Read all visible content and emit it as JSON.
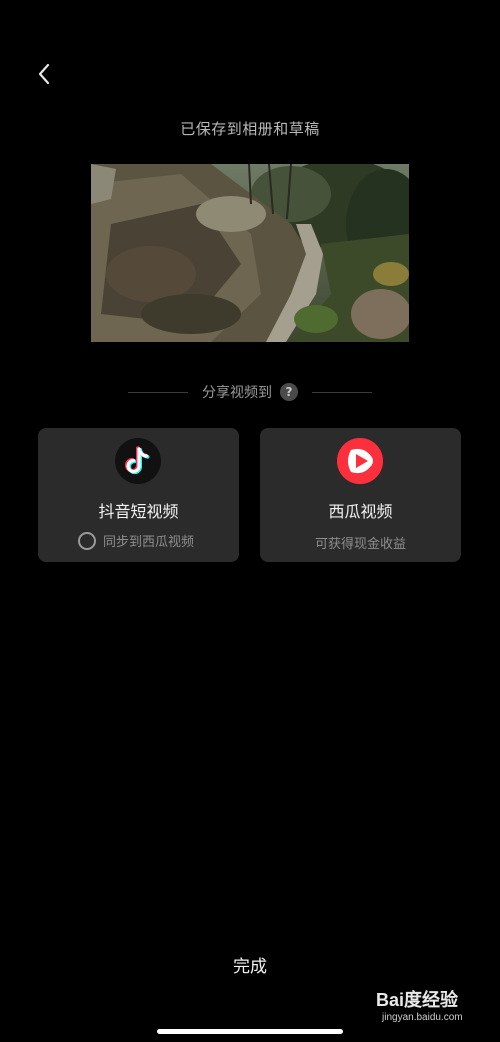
{
  "header": {
    "back_icon": "chevron-left-icon",
    "saved_message": "已保存到相册和草稿"
  },
  "preview": {
    "description_icon": "video-thumbnail"
  },
  "share": {
    "label": "分享视频到",
    "help_icon": "question-icon",
    "help_glyph": "?"
  },
  "cards": [
    {
      "title": "抖音短视频",
      "icon": "douyin-icon",
      "sync_label": "同步到西瓜视频",
      "sync_checked": false
    },
    {
      "title": "西瓜视频",
      "icon": "xigua-icon",
      "subtitle": "可获得现金收益"
    }
  ],
  "footer": {
    "done_label": "完成"
  },
  "watermark": {
    "main": "Bai度经验",
    "sub": "jingyan.baidu.com"
  },
  "colors": {
    "background": "#000000",
    "card": "#2b2b2b",
    "xigua_red": "#fc2f3d",
    "douyin_cyan": "#25f4ee",
    "douyin_pink": "#fe2c55"
  }
}
